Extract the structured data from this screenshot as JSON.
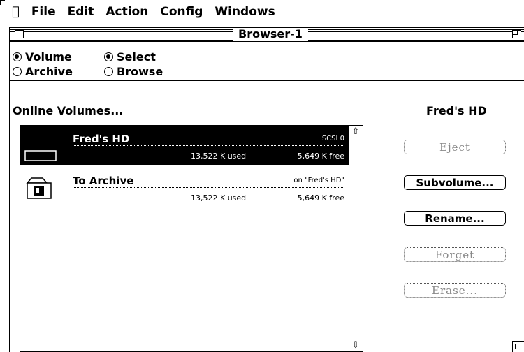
{
  "menubar": {
    "apple_icon": "apple-logo-icon",
    "items": [
      "File",
      "Edit",
      "Action",
      "Config",
      "Windows"
    ]
  },
  "window": {
    "title": "Browser-1"
  },
  "radios": {
    "volume": "Volume",
    "archive": "Archive",
    "select": "Select",
    "browse": "Browse",
    "selected_left": "Volume",
    "selected_right": "Select"
  },
  "panel": {
    "online_label": "Online Volumes...",
    "selected_volume": "Fred's HD"
  },
  "volumes": [
    {
      "name": "Fred's HD",
      "tag": "SCSI 0",
      "used": "13,522 K used",
      "free": "5,649 K free",
      "icon": "hard-disk-icon",
      "selected": true
    },
    {
      "name": "To Archive",
      "tag": "on \"Fred's HD\"",
      "used": "13,522 K used",
      "free": "5,649 K free",
      "icon": "archive-folder-icon",
      "selected": false
    }
  ],
  "buttons": {
    "eject": "Eject",
    "subvolume": "Subvolume...",
    "rename": "Rename...",
    "forget": "Forget",
    "erase": "Erase..."
  }
}
